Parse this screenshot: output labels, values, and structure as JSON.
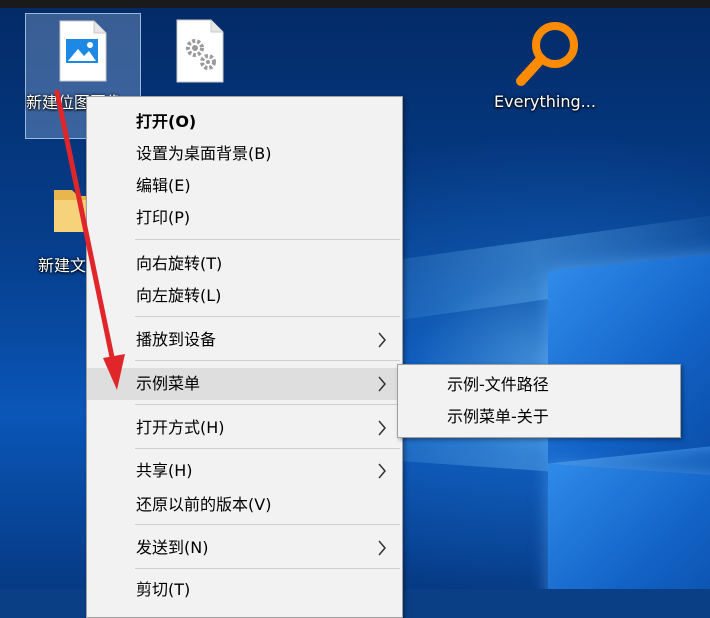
{
  "desktop": {
    "icons": [
      {
        "label": "新建位图图像.png",
        "icon": "image-file-icon",
        "selected": true
      },
      {
        "label": "",
        "icon": "settings-file-icon"
      },
      {
        "label": "Everything...",
        "icon": "everything-search-icon"
      },
      {
        "label": "新建文件夹",
        "icon": "folder-icon"
      }
    ]
  },
  "context_menu": {
    "items": [
      {
        "label": "打开(O)",
        "bold": true
      },
      {
        "label": "设置为桌面背景(B)"
      },
      {
        "label": "编辑(E)"
      },
      {
        "label": "打印(P)"
      },
      {
        "label": "向右旋转(T)"
      },
      {
        "label": "向左旋转(L)"
      },
      {
        "label": "播放到设备",
        "submenu": true
      },
      {
        "label": "示例菜单",
        "submenu": true,
        "highlighted": true
      },
      {
        "label": "打开方式(H)",
        "submenu": true
      },
      {
        "label": "共享(H)",
        "submenu": true
      },
      {
        "label": "还原以前的版本(V)"
      },
      {
        "label": "发送到(N)",
        "submenu": true
      },
      {
        "label": "剪切(T)"
      }
    ]
  },
  "submenu": {
    "items": [
      {
        "label": "示例-文件路径"
      },
      {
        "label": "示例菜单-关于"
      }
    ]
  },
  "annotation": {
    "arrow_color": "#e0262a"
  }
}
